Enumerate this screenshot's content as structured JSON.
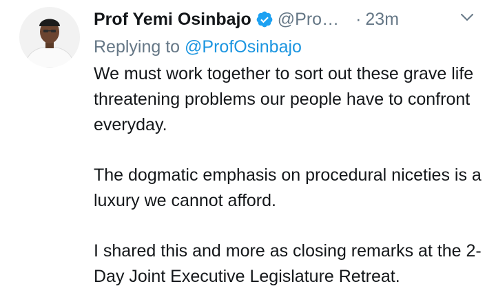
{
  "tweet": {
    "author": {
      "display_name": "Prof Yemi Osinbajo",
      "handle": "@Pro…",
      "verified_icon": "verified-badge-icon",
      "avatar_icon": "profile-avatar"
    },
    "separator": "·",
    "timestamp": "23m",
    "menu_icon": "chevron-down-icon",
    "replying_to": {
      "prefix": "Replying to",
      "handle": "@ProfOsinbajo"
    },
    "paragraphs": [
      "We must work together to sort out these grave life threatening problems our people have to confront everyday.",
      "The dogmatic emphasis on procedural niceties is a luxury we cannot afford.",
      "I shared this and more as closing remarks at the 2-Day Joint Executive Legislature Retreat."
    ]
  },
  "colors": {
    "text": "#14171a",
    "muted": "#657786",
    "link": "#1b95e0",
    "verified": "#1da1f2"
  }
}
